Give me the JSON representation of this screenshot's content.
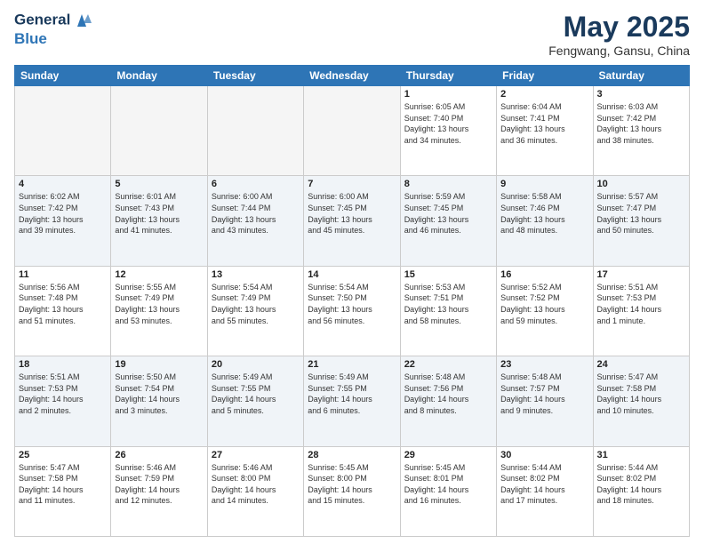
{
  "header": {
    "logo_line1": "General",
    "logo_line2": "Blue",
    "title": "May 2025",
    "subtitle": "Fengwang, Gansu, China"
  },
  "weekdays": [
    "Sunday",
    "Monday",
    "Tuesday",
    "Wednesday",
    "Thursday",
    "Friday",
    "Saturday"
  ],
  "weeks": [
    [
      {
        "day": "",
        "info": ""
      },
      {
        "day": "",
        "info": ""
      },
      {
        "day": "",
        "info": ""
      },
      {
        "day": "",
        "info": ""
      },
      {
        "day": "1",
        "info": "Sunrise: 6:05 AM\nSunset: 7:40 PM\nDaylight: 13 hours\nand 34 minutes."
      },
      {
        "day": "2",
        "info": "Sunrise: 6:04 AM\nSunset: 7:41 PM\nDaylight: 13 hours\nand 36 minutes."
      },
      {
        "day": "3",
        "info": "Sunrise: 6:03 AM\nSunset: 7:42 PM\nDaylight: 13 hours\nand 38 minutes."
      }
    ],
    [
      {
        "day": "4",
        "info": "Sunrise: 6:02 AM\nSunset: 7:42 PM\nDaylight: 13 hours\nand 39 minutes."
      },
      {
        "day": "5",
        "info": "Sunrise: 6:01 AM\nSunset: 7:43 PM\nDaylight: 13 hours\nand 41 minutes."
      },
      {
        "day": "6",
        "info": "Sunrise: 6:00 AM\nSunset: 7:44 PM\nDaylight: 13 hours\nand 43 minutes."
      },
      {
        "day": "7",
        "info": "Sunrise: 6:00 AM\nSunset: 7:45 PM\nDaylight: 13 hours\nand 45 minutes."
      },
      {
        "day": "8",
        "info": "Sunrise: 5:59 AM\nSunset: 7:45 PM\nDaylight: 13 hours\nand 46 minutes."
      },
      {
        "day": "9",
        "info": "Sunrise: 5:58 AM\nSunset: 7:46 PM\nDaylight: 13 hours\nand 48 minutes."
      },
      {
        "day": "10",
        "info": "Sunrise: 5:57 AM\nSunset: 7:47 PM\nDaylight: 13 hours\nand 50 minutes."
      }
    ],
    [
      {
        "day": "11",
        "info": "Sunrise: 5:56 AM\nSunset: 7:48 PM\nDaylight: 13 hours\nand 51 minutes."
      },
      {
        "day": "12",
        "info": "Sunrise: 5:55 AM\nSunset: 7:49 PM\nDaylight: 13 hours\nand 53 minutes."
      },
      {
        "day": "13",
        "info": "Sunrise: 5:54 AM\nSunset: 7:49 PM\nDaylight: 13 hours\nand 55 minutes."
      },
      {
        "day": "14",
        "info": "Sunrise: 5:54 AM\nSunset: 7:50 PM\nDaylight: 13 hours\nand 56 minutes."
      },
      {
        "day": "15",
        "info": "Sunrise: 5:53 AM\nSunset: 7:51 PM\nDaylight: 13 hours\nand 58 minutes."
      },
      {
        "day": "16",
        "info": "Sunrise: 5:52 AM\nSunset: 7:52 PM\nDaylight: 13 hours\nand 59 minutes."
      },
      {
        "day": "17",
        "info": "Sunrise: 5:51 AM\nSunset: 7:53 PM\nDaylight: 14 hours\nand 1 minute."
      }
    ],
    [
      {
        "day": "18",
        "info": "Sunrise: 5:51 AM\nSunset: 7:53 PM\nDaylight: 14 hours\nand 2 minutes."
      },
      {
        "day": "19",
        "info": "Sunrise: 5:50 AM\nSunset: 7:54 PM\nDaylight: 14 hours\nand 3 minutes."
      },
      {
        "day": "20",
        "info": "Sunrise: 5:49 AM\nSunset: 7:55 PM\nDaylight: 14 hours\nand 5 minutes."
      },
      {
        "day": "21",
        "info": "Sunrise: 5:49 AM\nSunset: 7:55 PM\nDaylight: 14 hours\nand 6 minutes."
      },
      {
        "day": "22",
        "info": "Sunrise: 5:48 AM\nSunset: 7:56 PM\nDaylight: 14 hours\nand 8 minutes."
      },
      {
        "day": "23",
        "info": "Sunrise: 5:48 AM\nSunset: 7:57 PM\nDaylight: 14 hours\nand 9 minutes."
      },
      {
        "day": "24",
        "info": "Sunrise: 5:47 AM\nSunset: 7:58 PM\nDaylight: 14 hours\nand 10 minutes."
      }
    ],
    [
      {
        "day": "25",
        "info": "Sunrise: 5:47 AM\nSunset: 7:58 PM\nDaylight: 14 hours\nand 11 minutes."
      },
      {
        "day": "26",
        "info": "Sunrise: 5:46 AM\nSunset: 7:59 PM\nDaylight: 14 hours\nand 12 minutes."
      },
      {
        "day": "27",
        "info": "Sunrise: 5:46 AM\nSunset: 8:00 PM\nDaylight: 14 hours\nand 14 minutes."
      },
      {
        "day": "28",
        "info": "Sunrise: 5:45 AM\nSunset: 8:00 PM\nDaylight: 14 hours\nand 15 minutes."
      },
      {
        "day": "29",
        "info": "Sunrise: 5:45 AM\nSunset: 8:01 PM\nDaylight: 14 hours\nand 16 minutes."
      },
      {
        "day": "30",
        "info": "Sunrise: 5:44 AM\nSunset: 8:02 PM\nDaylight: 14 hours\nand 17 minutes."
      },
      {
        "day": "31",
        "info": "Sunrise: 5:44 AM\nSunset: 8:02 PM\nDaylight: 14 hours\nand 18 minutes."
      }
    ]
  ]
}
